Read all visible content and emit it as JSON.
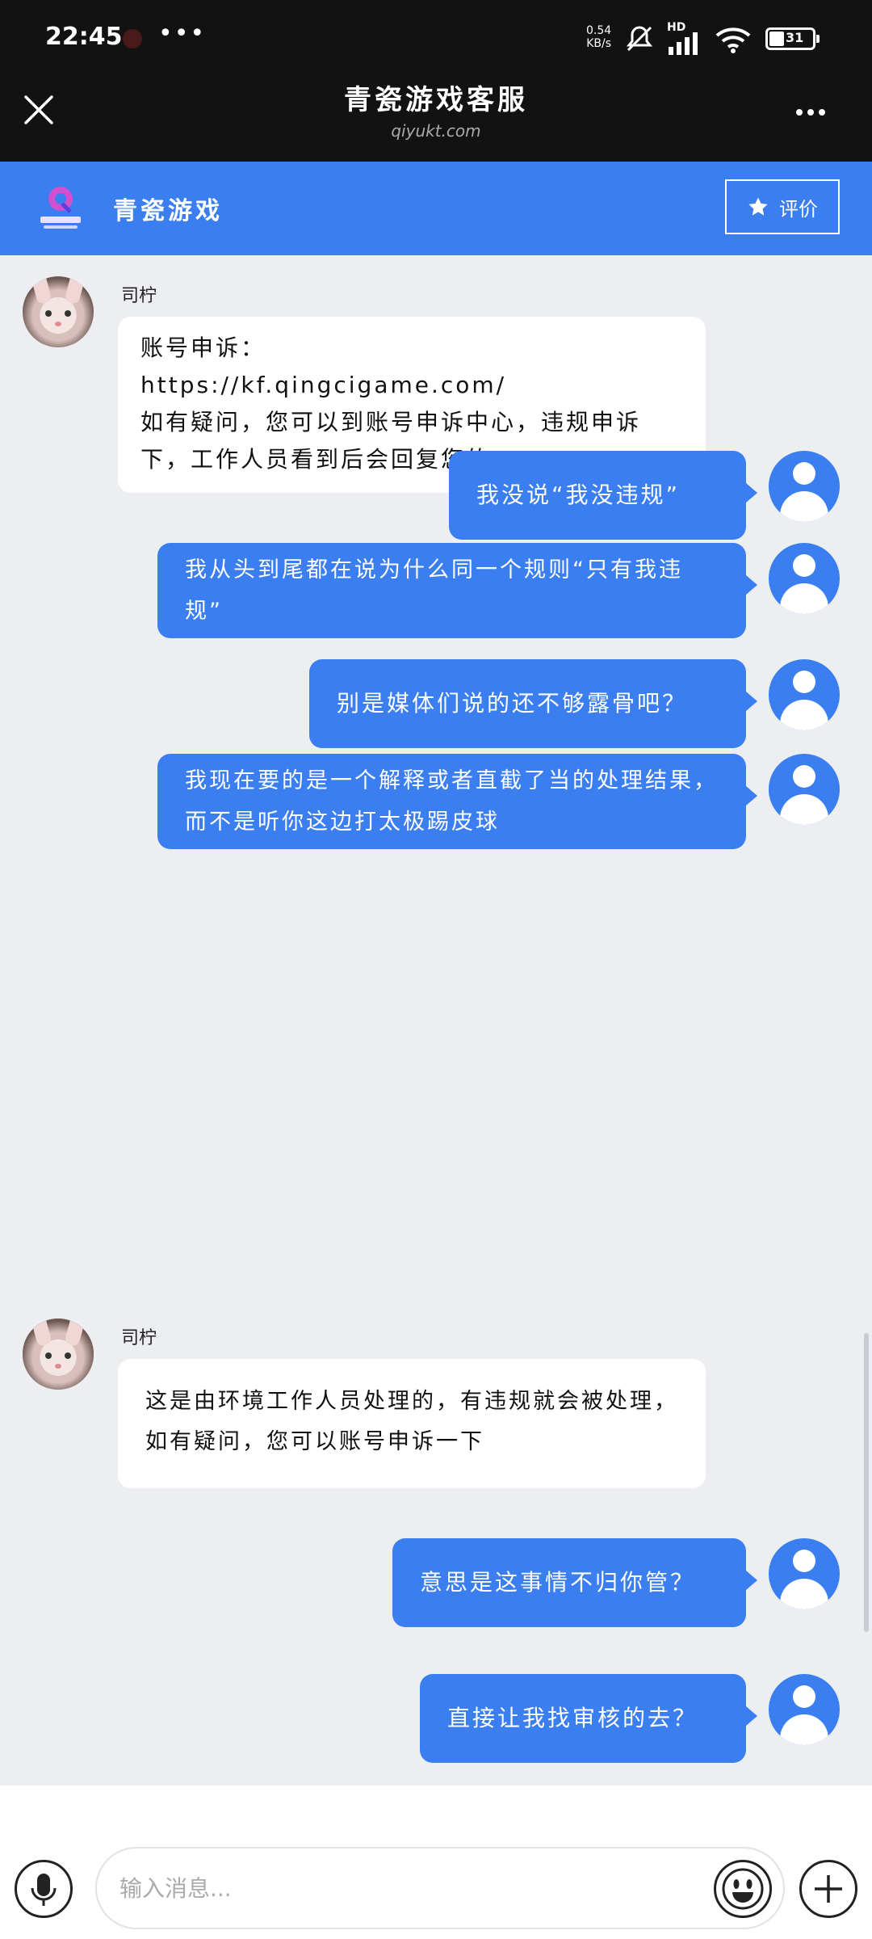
{
  "status_bar": {
    "time": "22:45",
    "dots": "•••",
    "net_speed": "0.54\nKB/s",
    "signal_label": "HD",
    "battery": "31"
  },
  "titlebar": {
    "title": "青瓷游戏客服",
    "subtitle": "qiyukt.com"
  },
  "brand": {
    "name": "青瓷游戏",
    "rate_label": "评价"
  },
  "messages": [
    {
      "side": "in",
      "sender": "司柠",
      "text": "账号申诉：\nhttps://kf.qingcigame.com/\n如有疑问，您可以到账号申诉中心，违规申诉下，工作人员看到后会回复您的"
    },
    {
      "side": "out",
      "text": "我没说“我没违规”"
    },
    {
      "side": "out",
      "text": "我从头到尾都在说为什么同一个规则“只有我违规”"
    },
    {
      "side": "out",
      "text": "别是媒体们说的还不够露骨吧？"
    },
    {
      "side": "out",
      "text": "我现在要的是一个解释或者直截了当的处理结果，而不是听你这边打太极踢皮球"
    },
    {
      "side": "in",
      "sender": "司柠",
      "text": "这是由环境工作人员处理的，有违规就会被处理，如有疑问，您可以账号申诉一下"
    },
    {
      "side": "out",
      "text": "意思是这事情不归你管？"
    },
    {
      "side": "out",
      "text": "直接让我找审核的去？"
    }
  ],
  "input": {
    "placeholder": "输入消息..."
  },
  "colors": {
    "accent": "#3a7ef0",
    "statusbar_bg": "#121212",
    "chat_bg": "#eceef2"
  },
  "icons": {
    "close": "close-icon",
    "more": "more-icon",
    "rate": "star-icon",
    "mic": "microphone-icon",
    "emoji": "emoji-icon",
    "plus": "plus-icon"
  }
}
